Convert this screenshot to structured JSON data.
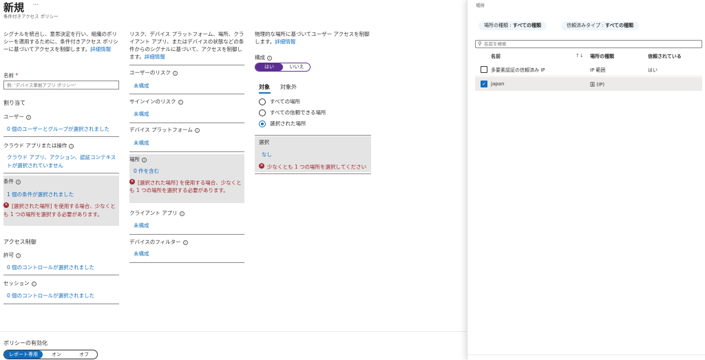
{
  "header": {
    "title": "新規",
    "more": "…",
    "subtitle": "条件付きアクセス ポリシー"
  },
  "col1": {
    "intro": "シグナルを統合し、意思決定を行い、組織のポリシーを適用するために、条件付きアクセス ポリシーに基づいてアクセスを制御します。",
    "learn_more": "詳細情報",
    "name_label": "名前",
    "name_required": "*",
    "name_placeholder": "例: 'デバイス準拠アプリ ポリシー'",
    "assignments_heading": "割り当て",
    "users_label": "ユーザー",
    "users_value": "0 個のユーザーとグループが選択されました",
    "cloud_apps_label": "クラウド アプリまたは操作",
    "cloud_apps_value": "クラウド アプリ、アクション、認証コンテキストが選択されていません",
    "conditions_label": "条件",
    "conditions_value": "1 個の条件が選択されました",
    "conditions_error": "[選択された場所] を使用する場合、少なくとも 1 つの場所を選択する必要があります。",
    "access_controls_heading": "アクセス制御",
    "grant_label": "許可",
    "grant_value": "0 個のコントロールが選択されました",
    "session_label": "セッション",
    "session_value": "0 個のコントロールが選択されました"
  },
  "col2": {
    "intro": "リスク、デバイス プラットフォーム、場所、クライアント アプリ、またはデバイスの状態などの条件からのシグナルに基づいて、アクセスを制御します。",
    "learn_more": "詳細情報",
    "user_risk_label": "ユーザーのリスク",
    "user_risk_value": "未構成",
    "signin_risk_label": "サインインのリスク",
    "signin_risk_value": "未構成",
    "device_platform_label": "デバイス プラットフォーム",
    "device_platform_value": "未構成",
    "locations_label": "場所",
    "locations_value": "0 件を含む",
    "locations_error": "[選択された場所] を使用する場合、少なくとも 1 つの場所を選択する必要があります。",
    "client_apps_label": "クライアント アプリ",
    "client_apps_value": "未構成",
    "device_filter_label": "デバイスのフィルター",
    "device_filter_value": "未構成"
  },
  "col3": {
    "intro": "物理的な場所に基づいてユーザー アクセスを制御します。",
    "learn_more": "詳細情報",
    "configure_label": "構成",
    "toggle_yes": "はい",
    "toggle_no": "いいえ",
    "tab_include": "対象",
    "tab_exclude": "対象外",
    "radio_any": "すべての場所",
    "radio_trusted": "すべての信頼できる場所",
    "radio_selected": "選択された場所",
    "select_label": "選択",
    "select_value": "なし",
    "select_error": "少なくとも 1 つの場所を選択してください"
  },
  "footer": {
    "enable_label": "ポリシーの有効化",
    "opt_report": "レポート専用",
    "opt_on": "オン",
    "opt_off": "オフ"
  },
  "panel": {
    "title": "場所",
    "filter_type_label": "場所の種類 : ",
    "filter_type_value": "すべての種類",
    "filter_trust_label": "信頼済みタイプ : ",
    "filter_trust_value": "すべての種類",
    "search_placeholder": "名前を検索",
    "columns": [
      "名前",
      "場所の種類",
      "信頼されている"
    ],
    "sort_glyph": "↑↓",
    "rows": [
      {
        "name": "多要素認証の信頼済み IP",
        "type": "IP 範囲",
        "trusted": "はい",
        "checked": false
      },
      {
        "name": "japan",
        "type": "国 (IP)",
        "trusted": "",
        "checked": true
      }
    ]
  },
  "colors": {
    "accent": "#0f6cbd",
    "toggle_purple": "#5c2e91",
    "error": "#a4262c",
    "pill_bg": "#eef5fc",
    "box_gray": "#e4e4e4"
  }
}
